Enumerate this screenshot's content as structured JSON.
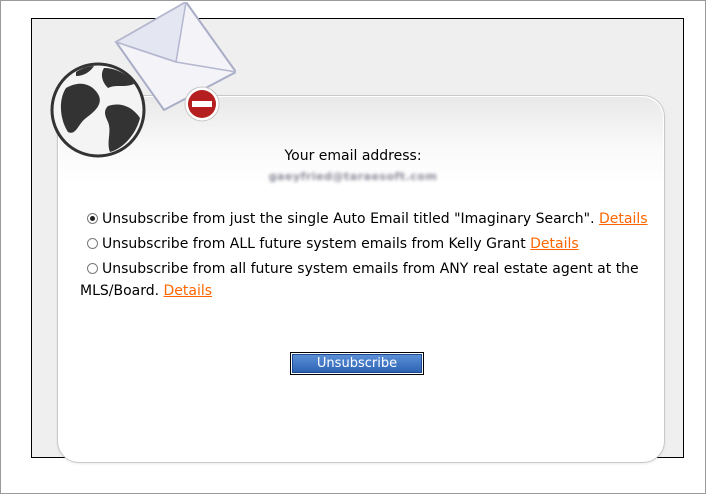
{
  "email": {
    "label": "Your email address:",
    "value": "gaeyfried@taraesoft.com"
  },
  "options": [
    {
      "checked": true,
      "text": "Unsubscribe from just the single Auto Email titled \"Imaginary Search\".",
      "details": "Details"
    },
    {
      "checked": false,
      "text": "Unsubscribe from ALL future system emails from Kelly Grant",
      "details": "Details"
    },
    {
      "checked": false,
      "text": "Unsubscribe from all future system emails from ANY real estate agent at the MLS/Board.",
      "details": "Details"
    }
  ],
  "submit": {
    "label": "Unsubscribe"
  },
  "colors": {
    "link": "#ff6600",
    "button": "#3b73c4",
    "stop": "#b51f1f"
  },
  "icons": {
    "logo": "globe-envelope-icon",
    "stop": "stop-icon"
  }
}
